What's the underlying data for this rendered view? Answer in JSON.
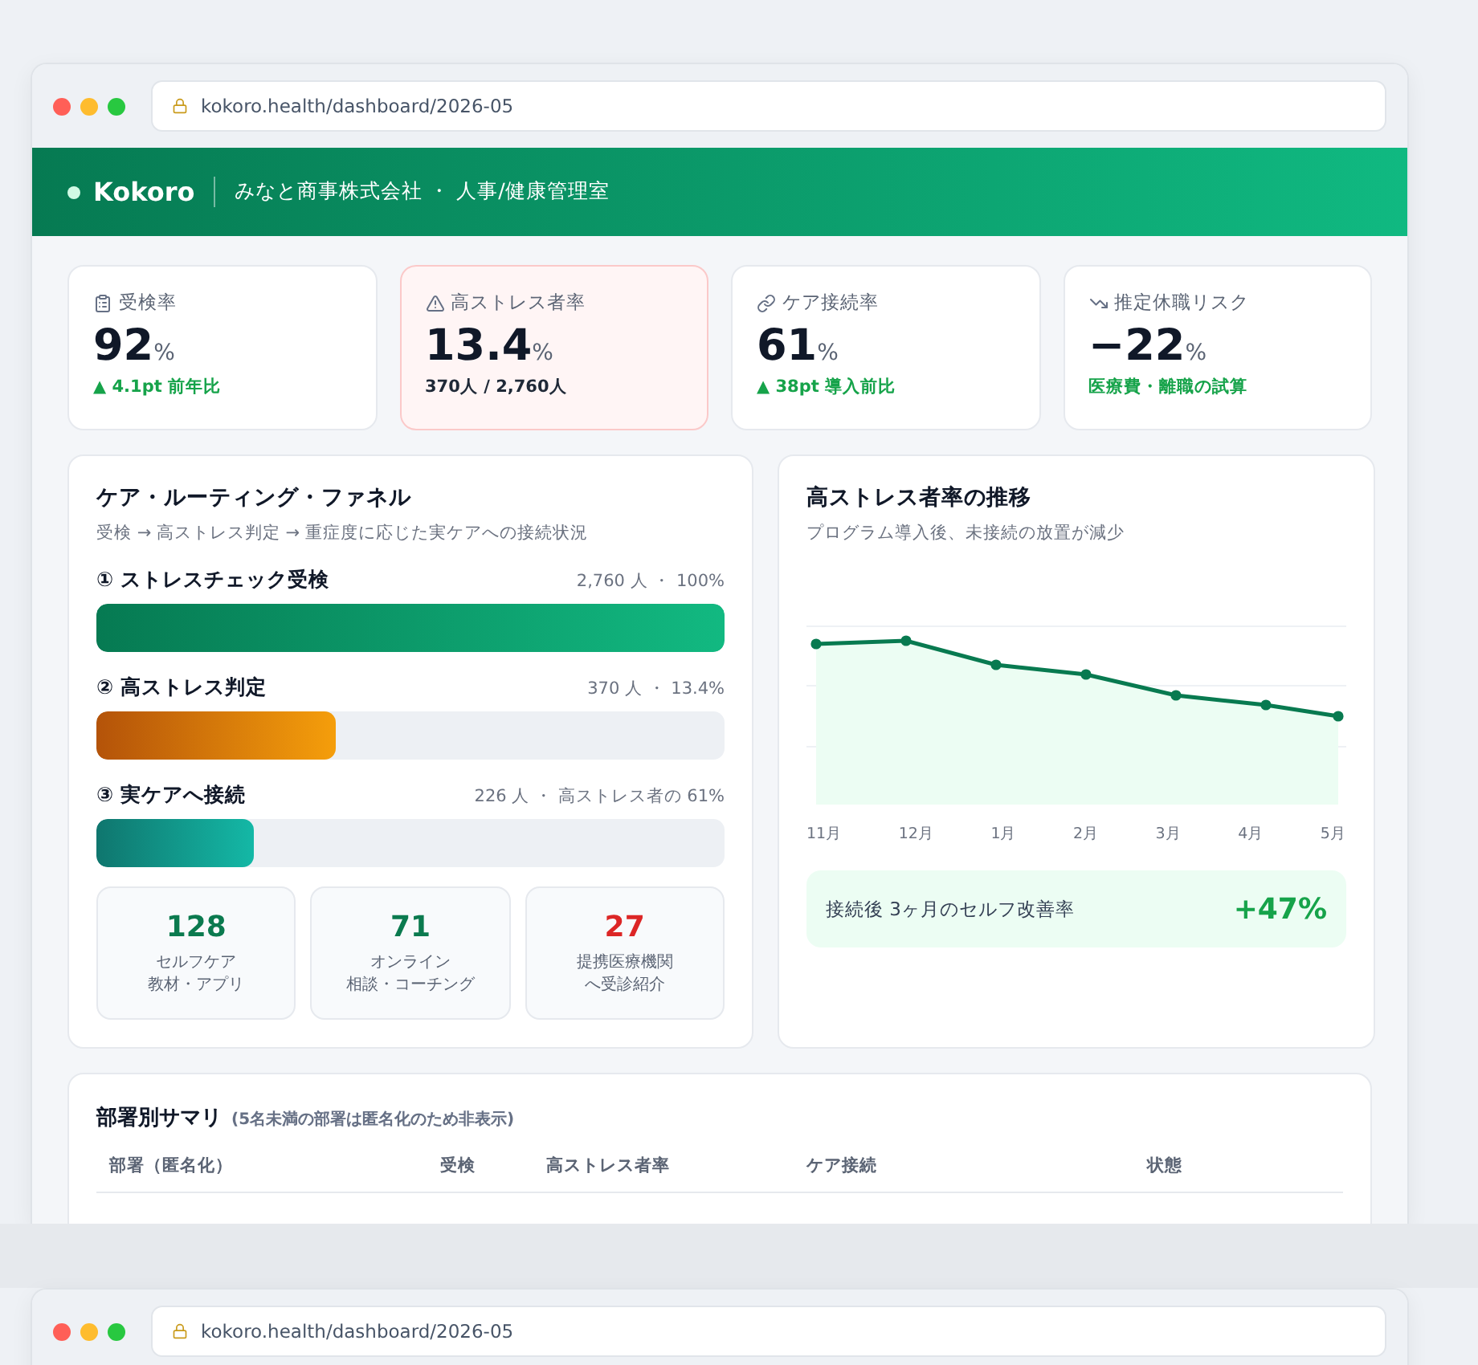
{
  "windows": [
    {
      "address": "kokoro.health/dashboard/2026-05",
      "header": {
        "brand": "Kokoro",
        "org": "みなと商事株式会社 ・ 人事/健康管理室"
      },
      "kpis": [
        {
          "label": "受検率",
          "value": "92",
          "unit": "%",
          "note": "▲ 4.1pt 前年比",
          "kind": "up",
          "alert": false
        },
        {
          "label": "高ストレス者率",
          "value": "13.4",
          "unit": "%",
          "note": "370人 / 2,760人",
          "kind": "neutral",
          "alert": true
        },
        {
          "label": "ケア接続率",
          "value": "61",
          "unit": "%",
          "note": "▲ 38pt 導入前比",
          "kind": "up",
          "alert": false
        },
        {
          "label": "推定休職リスク",
          "value": "−22",
          "unit": "%",
          "note": "医療費・離職の試算",
          "kind": "up",
          "alert": false
        }
      ],
      "funnel": {
        "title": "ケア・ルーティング・ファネル",
        "subtitle": "受検 → 高ストレス判定 → 重症度に応じた実ケアへの接続状況",
        "steps": [
          {
            "label": "① ストレスチェック受検",
            "reading": "2,760 人 ・ 100%",
            "level": 1,
            "kind": "green"
          },
          {
            "label": "② 高ストレス判定",
            "reading": "370 人 ・ 13.4%",
            "level": 0.38,
            "kind": "orange"
          },
          {
            "label": "③ 実ケアへ接続",
            "reading": "226 人 ・ 高ストレス者の 61%",
            "level": 0.25,
            "kind": "teal"
          }
        ],
        "outcomes": [
          {
            "value": "128",
            "lines": [
              "セルフケア",
              "教材・アプリ"
            ],
            "color": "#0b7a4f"
          },
          {
            "value": "71",
            "lines": [
              "オンライン",
              "相談・コーチング"
            ],
            "color": "#0b7a4f"
          },
          {
            "value": "27",
            "lines": [
              "提携医療機関",
              "へ受診紹介"
            ],
            "color": "#dc2626"
          }
        ]
      },
      "trend": {
        "title": "高ストレス者率の推移",
        "subtitle": "プログラム導入後、未接続の放置が減少",
        "months": [
          "11月",
          "12月",
          "1月",
          "2月",
          "3月",
          "4月",
          "5月"
        ],
        "highlight": {
          "label": "接続後 3ヶ月のセルフ改善率",
          "value": "+47%"
        }
      },
      "table": {
        "title": "部署別サマリ",
        "note": "(5名未満の部署は匿名化のため非表示)",
        "columns": [
          "部署（匿名化）",
          "受検",
          "高ストレス者率",
          "ケア接続",
          "状態"
        ]
      }
    },
    {
      "address": "kokoro.health/dashboard/2026-05"
    }
  ]
}
